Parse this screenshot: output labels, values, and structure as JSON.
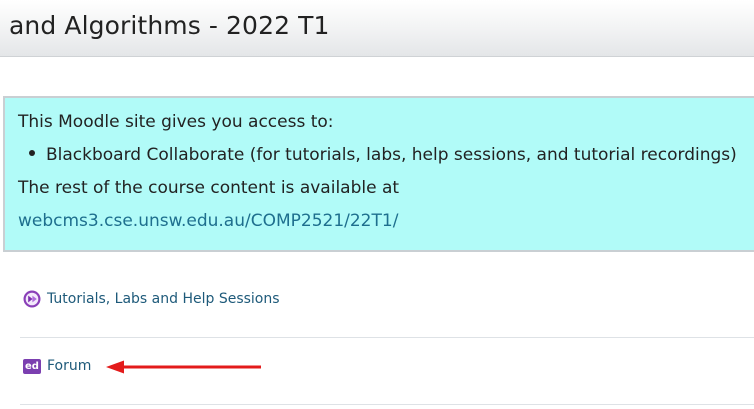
{
  "header": {
    "course_title": "and Algorithms - 2022 T1"
  },
  "notice": {
    "intro": "This Moodle site gives you access to:",
    "bullets": [
      "Blackboard Collaborate (for tutorials, labs, help sessions, and tutorial recordings)"
    ],
    "rest": "The rest of the course content is available at",
    "link": "webcms3.cse.unsw.edu.au/COMP2521/22T1/",
    "background_color": "#b1fbf8"
  },
  "activities": [
    {
      "label": "Tutorials, Labs and Help Sessions",
      "icon": "collaborate-icon"
    },
    {
      "label": "Forum",
      "icon": "ed-forum-icon",
      "icon_text": "ed"
    }
  ],
  "annotation": {
    "arrow_color": "#e31b1b",
    "arrow_icon": "red-arrow-pointing-left"
  }
}
